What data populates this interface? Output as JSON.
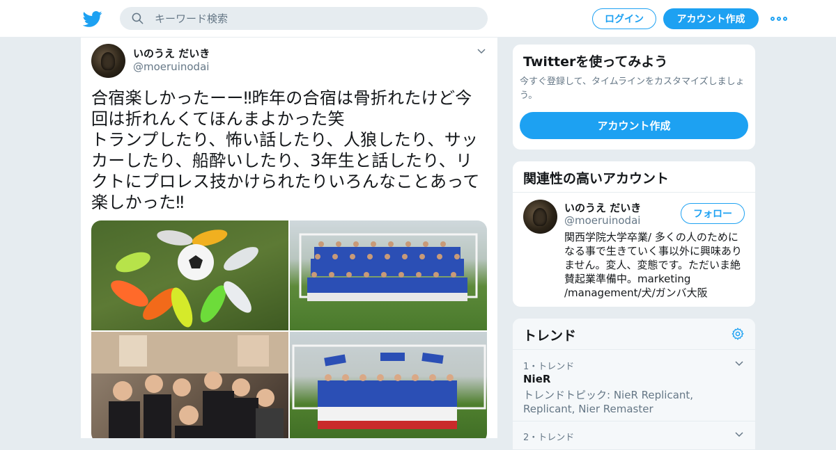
{
  "header": {
    "search_placeholder": "キーワード検索",
    "login_label": "ログイン",
    "signup_label": "アカウント作成",
    "brand_color": "#1da1f2"
  },
  "tweet": {
    "author_name": "いのうえ だいき",
    "author_handle": "@moeruinodai",
    "text": "合宿楽しかったーー‼︎昨年の合宿は骨折れたけど今回は折れんくてほんまよかった笑\nトランプしたり、怖い話したり、人狼したり、サッカーしたり、船酔いしたり、3年生と話したり、リクトにプロレス技かけられたりいろんなことあって楽しかった‼︎",
    "photos": [
      "soccer-cleats-photo",
      "team-group-photo",
      "room-friends-photo",
      "celebration-lift-photo"
    ]
  },
  "sidebar": {
    "signup_card": {
      "title": "Twitterを使ってみよう",
      "subtitle": "今すぐ登録して、タイムラインをカスタマイズしましょう。",
      "button_label": "アカウント作成"
    },
    "related": {
      "title": "関連性の高いアカウント",
      "account": {
        "name": "いのうえ だいき",
        "handle": "@moeruinodai",
        "follow_label": "フォロー",
        "bio": "関西学院大学卒業/ 多くの人のためになる事で生きていく事以外に興味ありません。変人、変態です。ただいま絶賛起業準備中。marketing /management/犬/ガンバ大阪"
      }
    },
    "trends": {
      "title": "トレンド",
      "items": [
        {
          "meta": "1・トレンド",
          "title": "NieR",
          "desc": "トレンドトピック: NieR Replicant, Replicant, Nier Remaster"
        },
        {
          "meta": "2・トレンド",
          "title": "",
          "desc": ""
        }
      ]
    }
  }
}
